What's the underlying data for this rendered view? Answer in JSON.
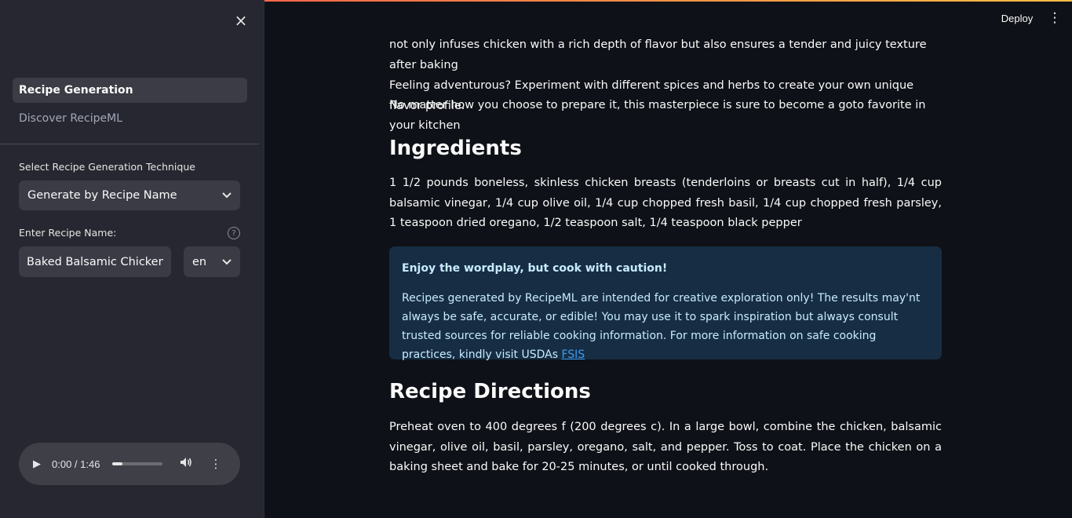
{
  "sidebar": {
    "close_icon": "×",
    "nav_items": [
      {
        "label": "Recipe Generation",
        "active": true
      },
      {
        "label": "Discover RecipeML",
        "active": false
      }
    ],
    "technique_label": "Select Recipe Generation Technique",
    "technique_value": "Generate by Recipe Name",
    "recipe_name_label": "Enter Recipe Name:",
    "recipe_name_value": "Baked Balsamic Chicken",
    "language_value": "en",
    "audio": {
      "time": "0:00 / 1:46",
      "progress": 0.2
    }
  },
  "header": {
    "deploy_label": "Deploy"
  },
  "main": {
    "intro_line": "not only infuses chicken with a rich depth of flavor but also ensures a tender and juicy texture after baking",
    "adventurous_line1": "Feeling adventurous? Experiment with different spices and herbs to create your own unique flavor profile.",
    "adventurous_line2": "No matter how you choose to prepare it, this masterpiece is sure to become a goto favorite in your kitchen",
    "ingredients_heading": "Ingredients",
    "ingredients_text": "1 1/2 pounds boneless, skinless chicken breasts (tenderloins or breasts cut in half), 1/4 cup balsamic vinegar, 1/4 cup olive oil, 1/4 cup chopped fresh basil, 1/4 cup chopped fresh parsley, 1 teaspoon dried oregano, 1/2 teaspoon salt, 1/4 teaspoon black pepper",
    "callout": {
      "title": "Enjoy the wordplay, but cook with caution!",
      "body": "Recipes generated by RecipeML are intended for creative exploration only! The results may'nt always be safe, accurate, or edible! You may use it to spark inspiration but always consult trusted sources for reliable cooking information. For more information on safe cooking practices, kindly visit USDAs ",
      "link": "FSIS"
    },
    "directions_heading": "Recipe Directions",
    "directions_text": "Preheat oven to 400 degrees f (200 degrees c). In a large bowl, combine the chicken, balsamic vinegar, olive oil, basil, parsley, oregano, salt, and pepper. Toss to coat. Place the chicken on a baking sheet and bake for 20-25 minutes, or until cooked through."
  },
  "colors": {
    "app_bg": "#0e1117",
    "sidebar_bg": "#262730",
    "callout_bg": "#172d43",
    "callout_text": "#c7ebff",
    "link": "#3d9df3"
  }
}
